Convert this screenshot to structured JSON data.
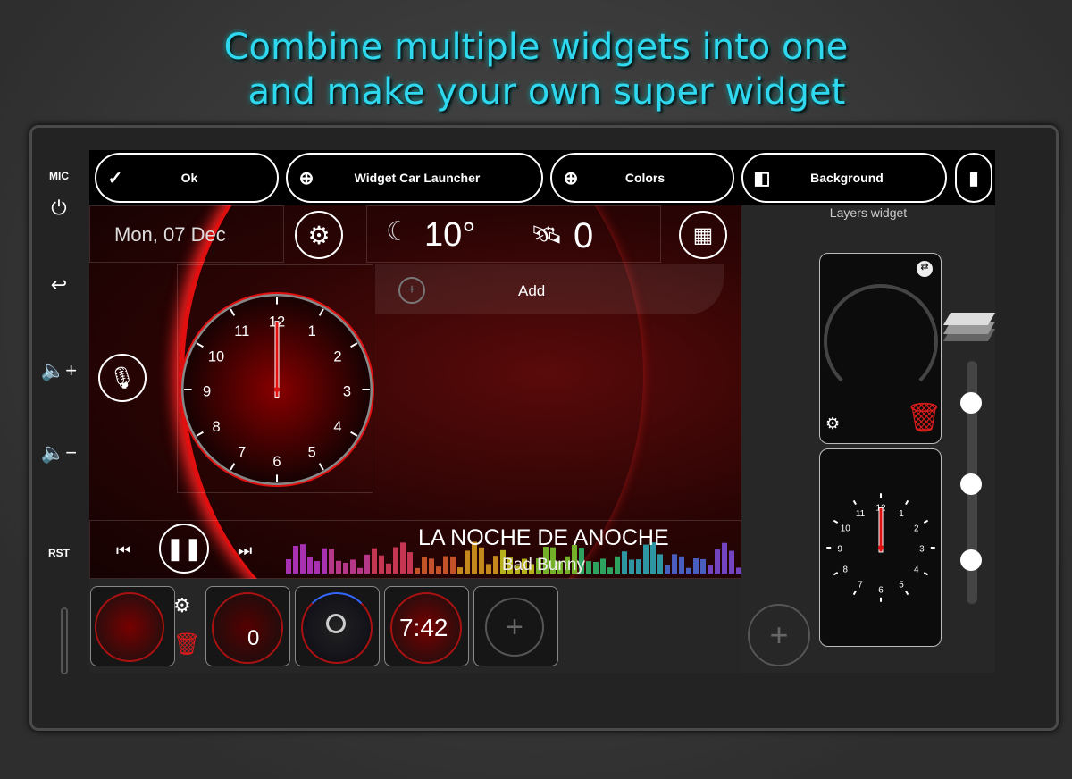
{
  "headline": {
    "line1": "Combine multiple widgets into one",
    "line2": "and make your own super widget"
  },
  "device": {
    "mic_label": "MIC",
    "rst_label": "RST",
    "icons": [
      "power-icon",
      "back-icon",
      "volume-up-icon",
      "volume-down-icon"
    ]
  },
  "toolbar": {
    "ok_label": "Ok",
    "widget_label": "Widget Car Launcher",
    "colors_label": "Colors",
    "background_label": "Background",
    "ok_icon": "check-icon",
    "plus_icon": "plus-circle-icon",
    "background_icon": "image-swap-icon",
    "save_icon": "sd-card-icon"
  },
  "main": {
    "date": "Mon, 07 Dec",
    "temperature": "10°",
    "weather_icon": "moon-cloud-icon",
    "satellites": "0",
    "add_label": "Add",
    "song_title": "LA NOCHE DE ANOCHE",
    "artist": "Bad Bunny"
  },
  "clock_numbers": [
    "12",
    "1",
    "2",
    "3",
    "4",
    "5",
    "6",
    "7",
    "8",
    "9",
    "10",
    "11"
  ],
  "right_panel": {
    "title": "Layers widget"
  },
  "thumbnails": {
    "speed": "0",
    "time": "7:42"
  },
  "colors": {
    "accent_red": "#e01010",
    "headline": "#2fd8ee",
    "trash": "#d81c1c"
  }
}
